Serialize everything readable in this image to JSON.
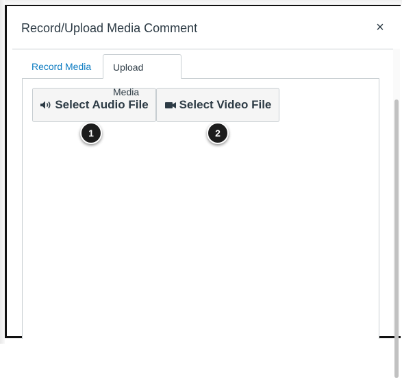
{
  "dialog": {
    "title": "Record/Upload Media Comment",
    "close_symbol": "×"
  },
  "tabs": [
    {
      "label": "Record Media",
      "active": false
    },
    {
      "label": "Upload Media",
      "active": true
    }
  ],
  "buttons": {
    "audio": {
      "label": "Select Audio File",
      "icon": "speaker-icon"
    },
    "video": {
      "label": "Select Video File",
      "icon": "video-camera-icon"
    }
  },
  "callouts": [
    "1",
    "2"
  ],
  "colors": {
    "link": "#0b7bc1",
    "text": "#2d3b45",
    "border": "#c7cdd1",
    "button_bg": "#f5f5f5",
    "callout_bg": "#1d1d1d"
  }
}
